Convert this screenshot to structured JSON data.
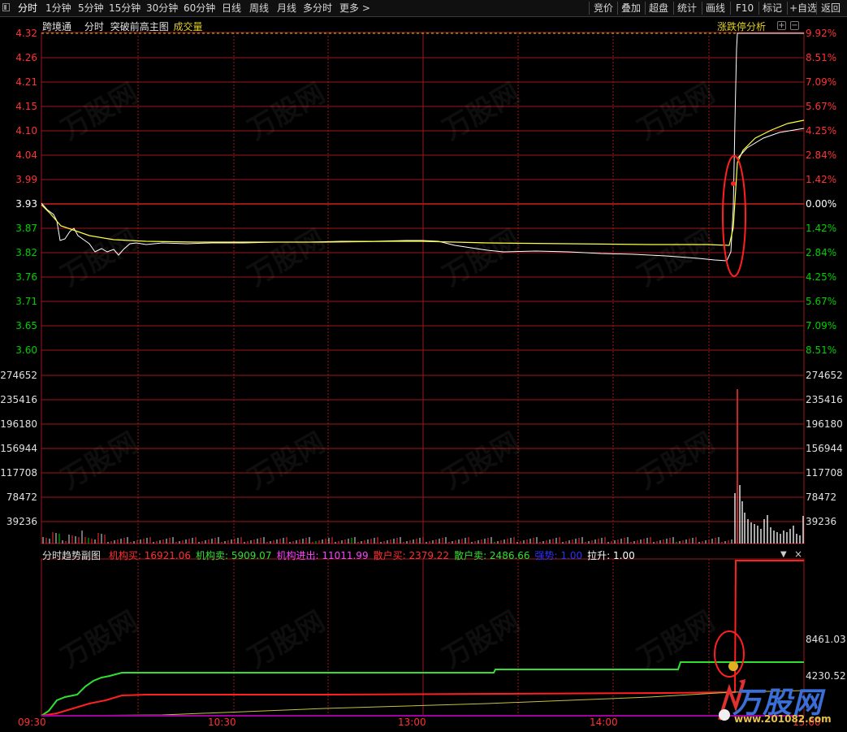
{
  "toolbar": {
    "left_tabs": [
      "分时",
      "1分钟",
      "5分钟",
      "15分钟",
      "30分钟",
      "60分钟",
      "日线",
      "周线",
      "月线",
      "多分时",
      "更多 >"
    ],
    "right_buttons": [
      "竞价",
      "叠加",
      "超盘",
      "统计",
      "画线",
      "F10",
      "标记",
      "+自选",
      "返回"
    ]
  },
  "main_panel": {
    "labels": [
      "跨境通",
      "分时",
      "突破前高主图"
    ],
    "volume_label": "成交量",
    "right_link": "涨跌停分析",
    "price_ticks": [
      "4.32",
      "4.26",
      "4.21",
      "4.15",
      "4.10",
      "4.04",
      "3.99",
      "3.93",
      "3.87",
      "3.82",
      "3.76",
      "3.71",
      "3.65",
      "3.60"
    ],
    "pct_ticks": [
      "9.92%",
      "8.51%",
      "7.09%",
      "5.67%",
      "4.25%",
      "2.84%",
      "1.42%",
      "0.00%",
      "1.42%",
      "2.84%",
      "4.25%",
      "5.67%",
      "7.09%",
      "8.51%"
    ],
    "volume_ticks": [
      "274652",
      "235416",
      "196180",
      "156944",
      "117708",
      "78472",
      "39236"
    ],
    "colors": {
      "up": "#ff3232",
      "down": "#00d000",
      "neutral": "#ffffff",
      "price": "#ffffff",
      "avg": "#ffff40",
      "grid": "#a01818"
    }
  },
  "sub_panel": {
    "title": "分时趋势副图",
    "indicators": [
      {
        "label": "机构买:",
        "value": "16921.06",
        "color": "#ff3030"
      },
      {
        "label": "机构卖:",
        "value": "5909.07",
        "color": "#30e030"
      },
      {
        "label": "机构进出:",
        "value": "11011.99",
        "color": "#ff40ff"
      },
      {
        "label": "散户买:",
        "value": "2379.22",
        "color": "#ff3030"
      },
      {
        "label": "散户卖:",
        "value": "2486.66",
        "color": "#30e030"
      },
      {
        "label": "强势:",
        "value": "1.00",
        "color": "#3030ff"
      },
      {
        "label": "拉升:",
        "value": "1.00",
        "color": "#ffffff"
      }
    ],
    "right_ticks": [
      "8461.03",
      "4230.52"
    ]
  },
  "time_axis": [
    "09:30",
    "10:30",
    "13:00",
    "14:00",
    "15:00"
  ],
  "watermark": {
    "text": "万股网",
    "url": "www.201082.com"
  }
}
